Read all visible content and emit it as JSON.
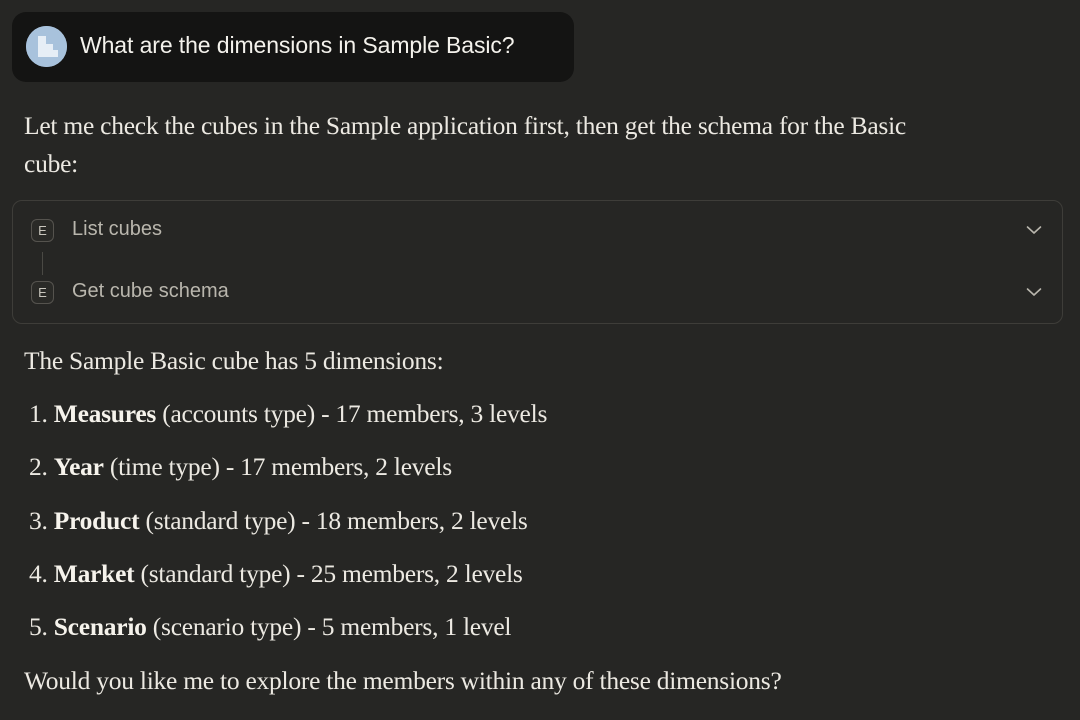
{
  "user_message": {
    "text": "What are the dimensions in Sample Basic?",
    "avatar_icon": "user-avatar-icon",
    "avatar_color": "#a8c2dc"
  },
  "assistant": {
    "intro_line1": "Let me check the cubes in the Sample application first, then get the schema for the Basic",
    "intro_line2": "cube:",
    "tool_calls": [
      {
        "badge": "E",
        "label": "List cubes",
        "icon": "chevron-down-icon"
      },
      {
        "badge": "E",
        "label": "Get cube schema",
        "icon": "chevron-down-icon"
      }
    ],
    "summary": "The Sample Basic cube has 5 dimensions:",
    "dimensions": [
      {
        "number": "1.",
        "name": "Measures",
        "detail": "(accounts type) - 17 members, 3 levels"
      },
      {
        "number": "2.",
        "name": "Year",
        "detail": "(time type) - 17 members, 2 levels"
      },
      {
        "number": "3.",
        "name": "Product",
        "detail": "(standard type) - 18 members, 2 levels"
      },
      {
        "number": "4.",
        "name": "Market",
        "detail": "(standard type) - 25 members, 2 levels"
      },
      {
        "number": "5.",
        "name": "Scenario",
        "detail": "(scenario type) - 5 members, 1 level"
      }
    ],
    "closing": "Would you like me to explore the members within any of these dimensions?"
  },
  "colors": {
    "background": "#262624",
    "bubble": "#141413",
    "text": "#ece9e2",
    "muted_text": "#b9b6ad",
    "border": "#3e3d39"
  }
}
